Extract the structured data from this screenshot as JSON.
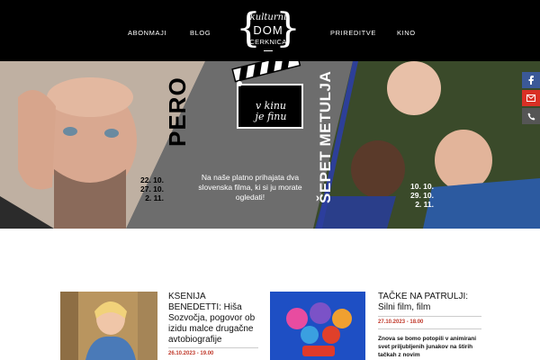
{
  "nav": {
    "items_left": [
      {
        "label": "ABONMAJI"
      },
      {
        "label": "BLOG"
      }
    ],
    "items_right": [
      {
        "label": "PRIREDITVE"
      },
      {
        "label": "KINO"
      }
    ]
  },
  "logo": {
    "line1": "kulturni",
    "line2": "DOM",
    "line3": "CERKNICA"
  },
  "banner": {
    "left_title": "PERO",
    "left_dates": [
      "22. 10.",
      "27. 10.",
      "2. 11."
    ],
    "clapper_line1": "v kinu",
    "clapper_line2": "je finu",
    "tagline": "Na naše platno prihajata dva slovenska filma, ki si ju morate ogledati!",
    "right_title": "ŠEPET METULJA",
    "right_dates": [
      "10. 10.",
      "29. 10.",
      "2. 11."
    ]
  },
  "social": {
    "items": [
      {
        "icon": "facebook-icon",
        "color": "#3b5998"
      },
      {
        "icon": "mail-icon",
        "color": "#d93025"
      },
      {
        "icon": "phone-icon",
        "color": "#555555"
      }
    ]
  },
  "cards": [
    {
      "title": "KSENIJA BENEDETTI: Hiša Sozvočja, pogovor ob izidu malce drugačne avtobiografije",
      "date": "26.10.2023 - 19.00"
    },
    {
      "title": "TAČKE NA PATRULJI: Silni film, film",
      "date": "27.10.2023 - 18.00",
      "desc": "Znova se bomo potopili v animirani svet priljubljenih junakov na štirih tačkah z novim"
    }
  ],
  "colors": {
    "accent": "#c0392b",
    "topbar": "#000000",
    "banner_mid": "#6b6b6b",
    "banner_right": "#2c3e9e"
  }
}
